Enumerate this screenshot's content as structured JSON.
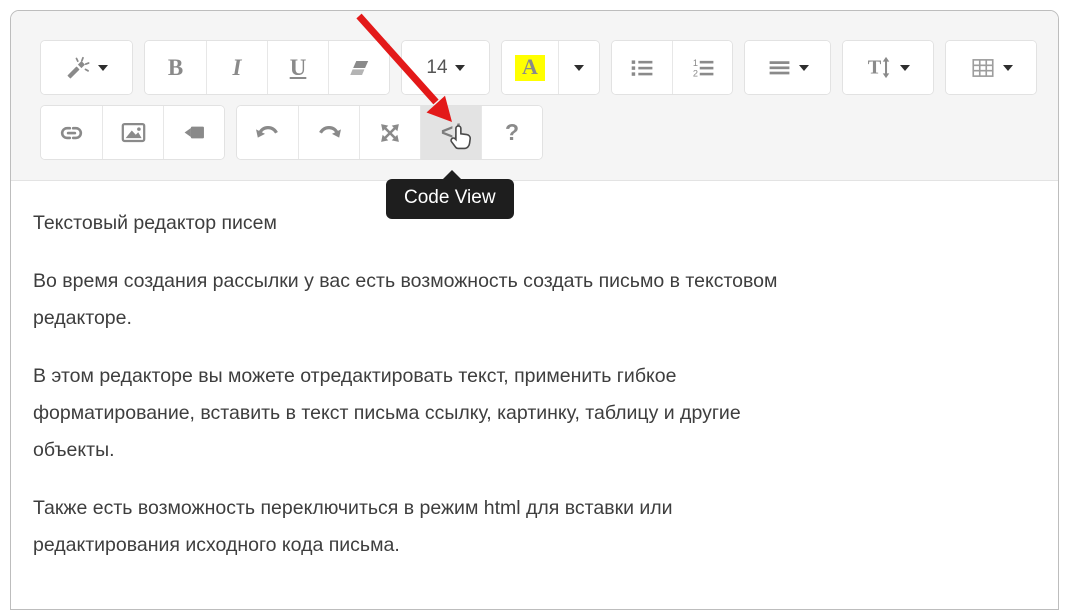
{
  "colors": {
    "toolbar_bg": "#f5f5f5",
    "button_border": "#e2e2e2",
    "icon_gray": "#8a8a8a",
    "active_button_bg": "#e3e3e3",
    "tooltip_bg": "#1e1e1e",
    "arrow_red": "#e31919",
    "highlight_yellow": "#ffff00",
    "text_color": "#3e3e3e"
  },
  "tooltip": {
    "text": "Code View"
  },
  "toolbar": {
    "bold_label": "B",
    "italic_label": "I",
    "underline_label": "U",
    "font_size_value": "14",
    "font_color_label": "A",
    "line_height_letter": "T",
    "ordered_list_numbers": [
      "1",
      "2"
    ],
    "code_view_label": "</",
    "help_label": "?"
  },
  "editor": {
    "heading": "Текстовый редактор писем",
    "paragraphs": [
      "Во время создания рассылки у вас есть возможность создать письмо в текстовом\nредакторе.",
      "В этом редакторе вы можете отредактировать текст, применить гибкое\nформатирование, вставить в текст письма ссылку, картинку, таблицу и другие\nобъекты.",
      "Также есть возможность переключиться в режим html для вставки или\nредактирования исходного кода письма."
    ]
  }
}
